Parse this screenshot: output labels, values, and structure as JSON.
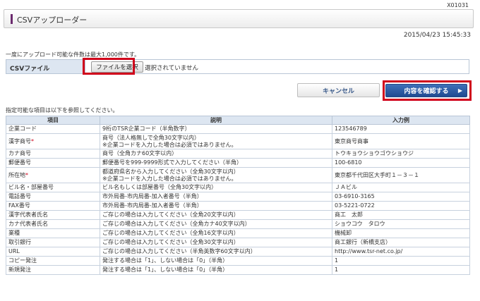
{
  "screen_id": "X01031",
  "page_title": "CSVアップローダー",
  "datetime": "2015/04/23 15:45:33",
  "notice": "一度にアップロード可能な件数は最大1,000件です。",
  "file_row": {
    "label": "CSVファイル",
    "button_label": "ファイルを選択",
    "status": "選択されていません"
  },
  "buttons": {
    "cancel": "キャンセル",
    "confirm": "内容を確認する"
  },
  "reference_caption": "指定可能な項目は以下を参照してください。",
  "table": {
    "headers": [
      "項目",
      "説明",
      "入力例"
    ],
    "rows": [
      {
        "item": "企業コード",
        "required": "",
        "desc1": "9桁のTSR企業コード（半角数字）",
        "desc2": "",
        "example": "123546789"
      },
      {
        "item": "漢字商号",
        "required": "*",
        "desc1": "商号（法人格無しで全角30文字以内）",
        "desc2": "※企業コードを入力した場合は必須ではありません。",
        "example": "東京商号商事"
      },
      {
        "item": "カナ商号",
        "required": "",
        "desc1": "商号（全角カナ60文字以内）",
        "desc2": "",
        "example": "トウキョウショウゴウショウジ"
      },
      {
        "item": "郵便番号",
        "required": "",
        "desc1": "郵便番号を999-9999形式で入力してください（半角）",
        "desc2": "",
        "example": "100-6810"
      },
      {
        "item": "所在地",
        "required": "*",
        "desc1": "都道府県名から入力してください（全角30文字以内）",
        "desc2": "※企業コードを入力した場合は必須ではありません。",
        "example": "東京都千代田区大手町１－３－１"
      },
      {
        "item": "ビル名・部屋番号",
        "required": "",
        "desc1": "ビル名もしくは部屋番号（全角30文字以内）",
        "desc2": "",
        "example": "ＪＡビル"
      },
      {
        "item": "電話番号",
        "required": "",
        "desc1": "市外局番-市内局番-加入者番号（半角）",
        "desc2": "",
        "example": "03-6910-3165"
      },
      {
        "item": "FAX番号",
        "required": "",
        "desc1": "市外局番-市内局番-加入者番号（半角）",
        "desc2": "",
        "example": "03-5221-0722"
      },
      {
        "item": "漢字代表者氏名",
        "required": "",
        "desc1": "ご存じの場合は入力してください（全角20文字以内）",
        "desc2": "",
        "example": "商工　太郎"
      },
      {
        "item": "カナ代表者氏名",
        "required": "",
        "desc1": "ご存じの場合は入力してください（全角カナ40文字以内）",
        "desc2": "",
        "example": "ショウコウ　タロウ"
      },
      {
        "item": "業種",
        "required": "",
        "desc1": "ご存じの場合は入力してください（全角16文字以内）",
        "desc2": "",
        "example": "機械卸"
      },
      {
        "item": "取引銀行",
        "required": "",
        "desc1": "ご存じの場合は入力してください（全角30文字以内）",
        "desc2": "",
        "example": "商工銀行（新橋支店）"
      },
      {
        "item": "URL",
        "required": "",
        "desc1": "ご存じの場合は入力してください（半角英数字60文字以内）",
        "desc2": "",
        "example": "http://www.tsr-net.co.jp/"
      },
      {
        "item": "コピー発注",
        "required": "",
        "desc1": "発注する場合は「1」、しない場合は「0」（半角）",
        "desc2": "",
        "example": "1"
      },
      {
        "item": "新規発注",
        "required": "",
        "desc1": "発注する場合は「1」、しない場合は「0」（半角）",
        "desc2": "",
        "example": "1"
      }
    ]
  },
  "colors": {
    "accent_bar": "#6b2a6e",
    "highlight": "#d0021b",
    "primary_button": "#2a559c",
    "table_header": "#dde6f1"
  }
}
